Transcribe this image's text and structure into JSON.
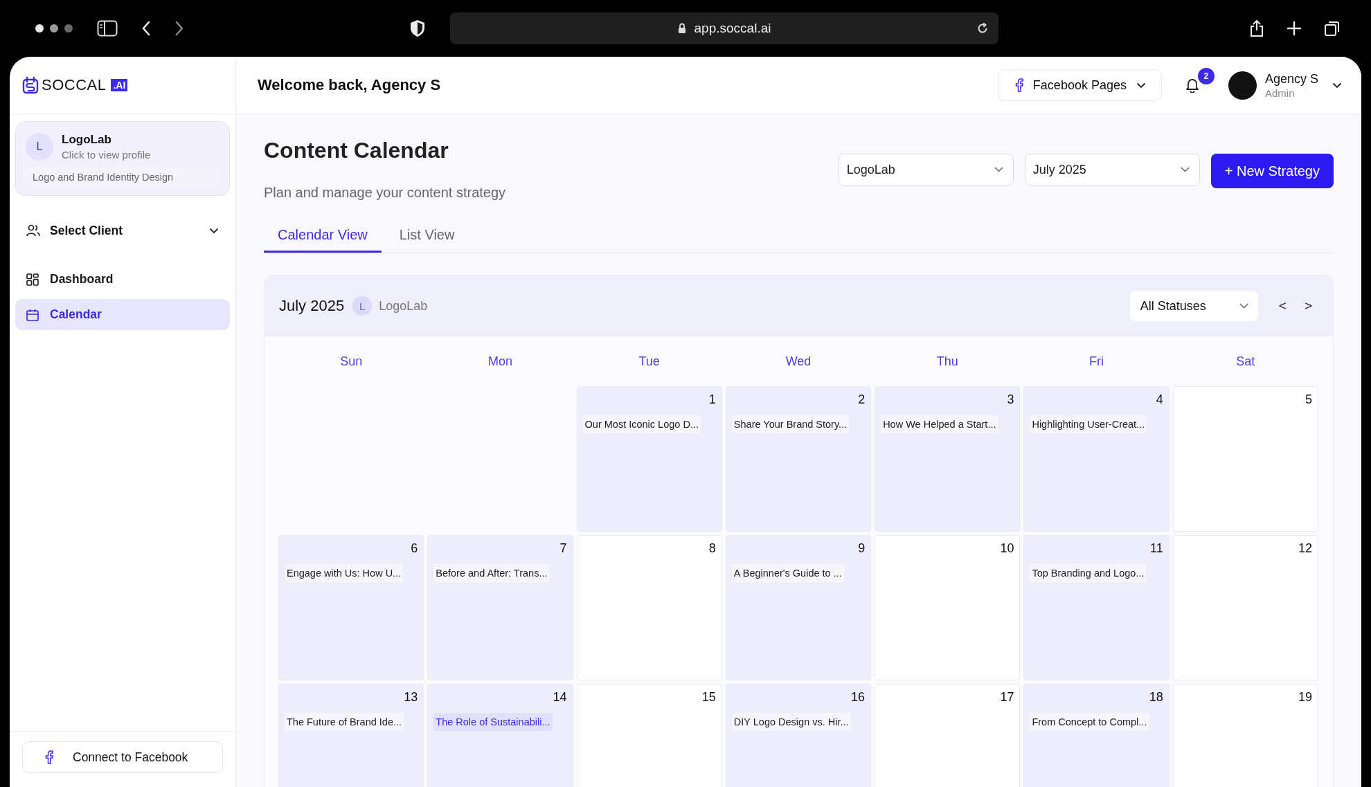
{
  "browser": {
    "url": "app.soccal.ai"
  },
  "sidebar": {
    "logo": {
      "text": "SOCCAL",
      "badge": ".AI"
    },
    "profile": {
      "initial": "L",
      "name": "LogoLab",
      "link": "Click to view profile",
      "description": "Logo and Brand Identity Design"
    },
    "client_select": {
      "label": "Select Client",
      "expanded": false
    },
    "items": [
      {
        "label": "Dashboard",
        "kind": "dashboard",
        "selected": false
      },
      {
        "label": "Calendar",
        "kind": "calendar",
        "selected": true
      }
    ],
    "connect_button": "Connect to Facebook"
  },
  "header": {
    "greeting": "Welcome back, Agency S",
    "pages_button": "Facebook Pages",
    "notification_count": "2",
    "user": {
      "name": "Agency S",
      "role": "Admin"
    }
  },
  "page": {
    "title": "Content Calendar",
    "subtitle": "Plan and manage your content strategy",
    "client_select": "LogoLab",
    "month_select": "July 2025",
    "new_button": "+ New Strategy"
  },
  "tabs": [
    {
      "label": "Calendar View",
      "selected": true
    },
    {
      "label": "List View",
      "selected": false
    }
  ],
  "calendar": {
    "month": "July 2025",
    "client_initial": "L",
    "client": "LogoLab",
    "status_filter": "All Statuses",
    "prev": "<",
    "next": ">",
    "weekdays": [
      "Sun",
      "Mon",
      "Tue",
      "Wed",
      "Thu",
      "Fri",
      "Sat"
    ],
    "weeks": [
      [
        {
          "kind": "blank"
        },
        {
          "kind": "blank"
        },
        {
          "kind": "day",
          "day": "1",
          "posts": [
            {
              "title": "Our Most Iconic Logo D...",
              "selected": false
            }
          ]
        },
        {
          "kind": "day",
          "day": "2",
          "posts": [
            {
              "title": "Share Your Brand Story...",
              "selected": false
            }
          ]
        },
        {
          "kind": "day",
          "day": "3",
          "posts": [
            {
              "title": "How We Helped a Start...",
              "selected": false
            }
          ]
        },
        {
          "kind": "day",
          "day": "4",
          "posts": [
            {
              "title": "Highlighting User-Creat...",
              "selected": false
            }
          ]
        },
        {
          "kind": "day",
          "day": "5"
        }
      ],
      [
        {
          "kind": "day",
          "day": "6",
          "posts": [
            {
              "title": "Engage with Us: How U...",
              "selected": false
            }
          ]
        },
        {
          "kind": "day",
          "day": "7",
          "posts": [
            {
              "title": "Before and After: Trans...",
              "selected": false
            }
          ]
        },
        {
          "kind": "day",
          "day": "8"
        },
        {
          "kind": "day",
          "day": "9",
          "posts": [
            {
              "title": "A Beginner's Guide to ...",
              "selected": false
            }
          ]
        },
        {
          "kind": "day",
          "day": "10"
        },
        {
          "kind": "day",
          "day": "11",
          "posts": [
            {
              "title": "Top Branding and Logo...",
              "selected": false
            }
          ]
        },
        {
          "kind": "day",
          "day": "12"
        }
      ],
      [
        {
          "kind": "day",
          "day": "13",
          "posts": [
            {
              "title": "The Future of Brand Ide...",
              "selected": false
            }
          ]
        },
        {
          "kind": "day",
          "day": "14",
          "posts": [
            {
              "title": "The Role of Sustainabili...",
              "selected": true
            }
          ]
        },
        {
          "kind": "day",
          "day": "15"
        },
        {
          "kind": "day",
          "day": "16",
          "posts": [
            {
              "title": "DIY Logo Design vs. Hir...",
              "selected": false
            }
          ]
        },
        {
          "kind": "day",
          "day": "17"
        },
        {
          "kind": "day",
          "day": "18",
          "posts": [
            {
              "title": "From Concept to Compl...",
              "selected": false
            }
          ]
        },
        {
          "kind": "day",
          "day": "19"
        }
      ]
    ]
  }
}
